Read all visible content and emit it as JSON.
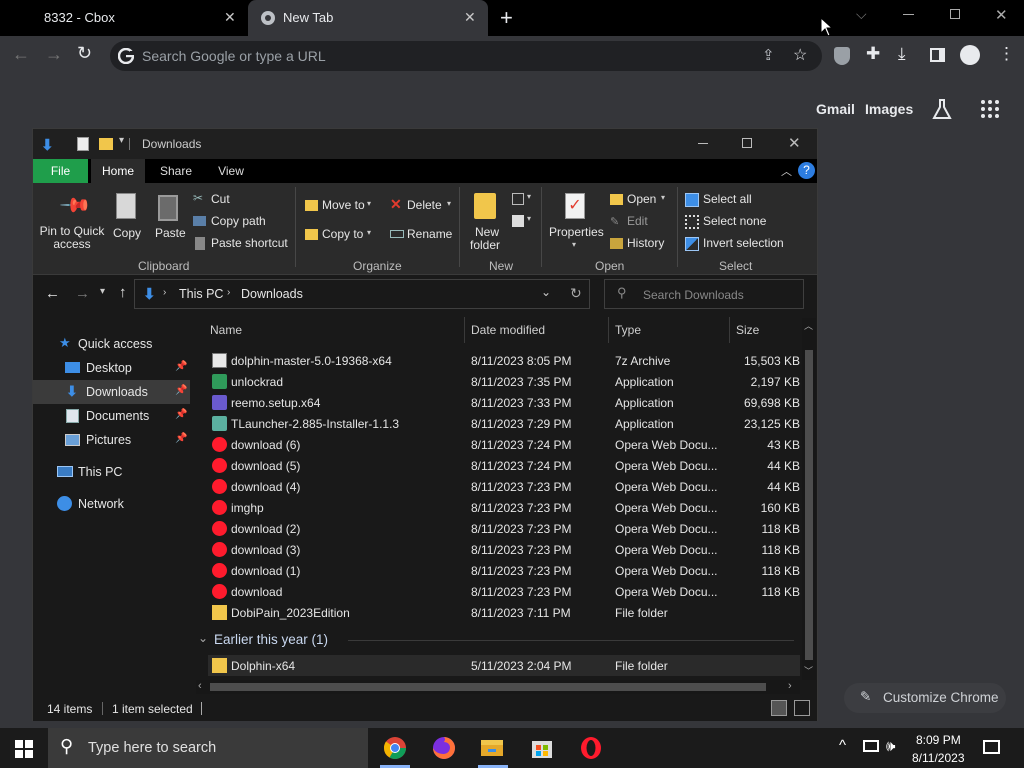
{
  "chrome": {
    "tabs": [
      {
        "title": "8332 - Cbox",
        "active": false
      },
      {
        "title": "New Tab",
        "active": true
      }
    ],
    "omnibox_placeholder": "Search Google or type a URL",
    "ntp_links": {
      "gmail": "Gmail",
      "images": "Images"
    },
    "customize_label": "Customize Chrome"
  },
  "explorer": {
    "title": "Downloads",
    "ribbon_tabs": [
      "File",
      "Home",
      "Share",
      "View"
    ],
    "clipboard": {
      "pin": "Pin to Quick access",
      "copy": "Copy",
      "paste": "Paste",
      "cut": "Cut",
      "copy_path": "Copy path",
      "paste_shortcut": "Paste shortcut",
      "label": "Clipboard"
    },
    "organize": {
      "move_to": "Move to",
      "copy_to": "Copy to",
      "delete": "Delete",
      "rename": "Rename",
      "label": "Organize"
    },
    "new": {
      "new_folder_line1": "New",
      "new_folder_line2": "folder",
      "label": "New"
    },
    "open": {
      "properties": "Properties",
      "open": "Open",
      "edit": "Edit",
      "history": "History",
      "label": "Open"
    },
    "select": {
      "select_all": "Select all",
      "select_none": "Select none",
      "invert": "Invert selection",
      "label": "Select"
    },
    "address": {
      "root": "This PC",
      "current": "Downloads"
    },
    "search_placeholder": "Search Downloads",
    "nav": {
      "quick_access": "Quick access",
      "items": [
        "Desktop",
        "Downloads",
        "Documents",
        "Pictures"
      ],
      "this_pc": "This PC",
      "network": "Network"
    },
    "columns": {
      "name": "Name",
      "date": "Date modified",
      "type": "Type",
      "size": "Size"
    },
    "files": [
      {
        "name": "dolphin-master-5.0-19368-x64",
        "date": "8/11/2023 8:05 PM",
        "type": "7z Archive",
        "size": "15,503 KB",
        "icon": "archive-icon"
      },
      {
        "name": "unlockrad",
        "date": "8/11/2023 7:35 PM",
        "type": "Application",
        "size": "2,197 KB",
        "icon": "app-icon"
      },
      {
        "name": "reemo.setup.x64",
        "date": "8/11/2023 7:33 PM",
        "type": "Application",
        "size": "69,698 KB",
        "icon": "installer-icon"
      },
      {
        "name": "TLauncher-2.885-Installer-1.1.3",
        "date": "8/11/2023 7:29 PM",
        "type": "Application",
        "size": "23,125 KB",
        "icon": "tlauncher-icon"
      },
      {
        "name": "download (6)",
        "date": "8/11/2023 7:24 PM",
        "type": "Opera Web Docu...",
        "size": "43 KB",
        "icon": "opera-icon"
      },
      {
        "name": "download (5)",
        "date": "8/11/2023 7:24 PM",
        "type": "Opera Web Docu...",
        "size": "44 KB",
        "icon": "opera-icon"
      },
      {
        "name": "download (4)",
        "date": "8/11/2023 7:23 PM",
        "type": "Opera Web Docu...",
        "size": "44 KB",
        "icon": "opera-icon"
      },
      {
        "name": "imghp",
        "date": "8/11/2023 7:23 PM",
        "type": "Opera Web Docu...",
        "size": "160 KB",
        "icon": "opera-icon"
      },
      {
        "name": "download (2)",
        "date": "8/11/2023 7:23 PM",
        "type": "Opera Web Docu...",
        "size": "118 KB",
        "icon": "opera-icon"
      },
      {
        "name": "download (3)",
        "date": "8/11/2023 7:23 PM",
        "type": "Opera Web Docu...",
        "size": "118 KB",
        "icon": "opera-icon"
      },
      {
        "name": "download (1)",
        "date": "8/11/2023 7:23 PM",
        "type": "Opera Web Docu...",
        "size": "118 KB",
        "icon": "opera-icon"
      },
      {
        "name": "download",
        "date": "8/11/2023 7:23 PM",
        "type": "Opera Web Docu...",
        "size": "118 KB",
        "icon": "opera-icon"
      },
      {
        "name": "DobiPain_2023Edition",
        "date": "8/11/2023 7:11 PM",
        "type": "File folder",
        "size": "",
        "icon": "folder-icon"
      }
    ],
    "group_earlier": "Earlier this year (1)",
    "earlier_files": [
      {
        "name": "Dolphin-x64",
        "date": "5/11/2023 2:04 PM",
        "type": "File folder",
        "size": "",
        "icon": "folder-icon"
      }
    ],
    "status": {
      "count": "14 items",
      "selected": "1 item selected"
    }
  },
  "taskbar": {
    "search_placeholder": "Type here to search",
    "time": "8:09 PM",
    "date": "8/11/2023"
  }
}
